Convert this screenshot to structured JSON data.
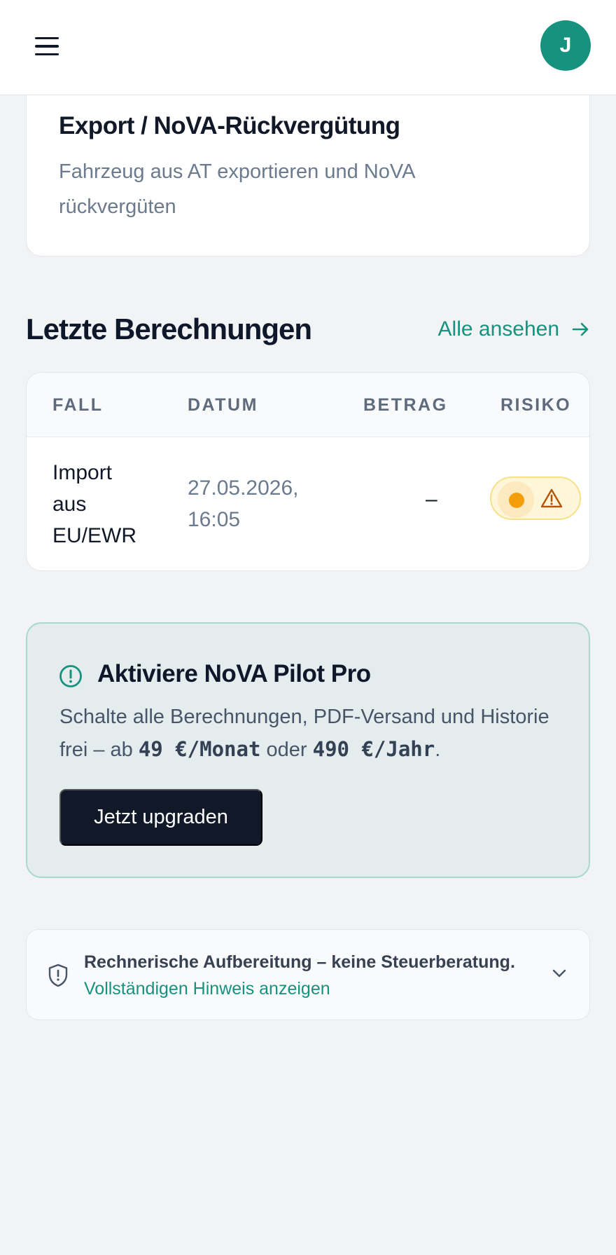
{
  "header": {
    "menu_icon": "hamburger-menu-icon",
    "avatar_initial": "J",
    "avatar_color": "#16927f"
  },
  "export_card": {
    "title": "Export / NoVA-Rückvergütung",
    "description": "Fahrzeug aus AT exportieren und NoVA rückvergüten"
  },
  "recent": {
    "title": "Letzte Berechnungen",
    "see_all_label": "Alle ansehen",
    "see_all_icon": "arrow-right-icon",
    "columns": {
      "fall": "FALL",
      "datum": "DATUM",
      "betrag": "BETRAG",
      "risiko": "RISIKO"
    },
    "rows": [
      {
        "fall": "Import aus EU/EWR",
        "datum": "27.05.2026, 16:05",
        "betrag": "–",
        "risiko_icon": "warning-triangle-icon",
        "risiko_color": "#f59e0b"
      }
    ]
  },
  "promo": {
    "icon": "info-circle-icon",
    "title": "Aktiviere NoVA Pilot Pro",
    "text_before": "Schalte alle Berechnungen, PDF-Versand und Historie frei – ab ",
    "price_month": "49 €/Monat",
    "text_middle": " oder ",
    "price_year": "490 €/Jahr",
    "text_after": ".",
    "button_label": "Jetzt upgraden",
    "accent_color": "#16927f"
  },
  "disclaimer": {
    "icon": "shield-icon",
    "main_text": "Rechnerische Aufbereitung – keine Steuerberatung.",
    "link_text": "Vollständigen Hinweis anzeigen",
    "chevron_icon": "chevron-down-icon"
  }
}
